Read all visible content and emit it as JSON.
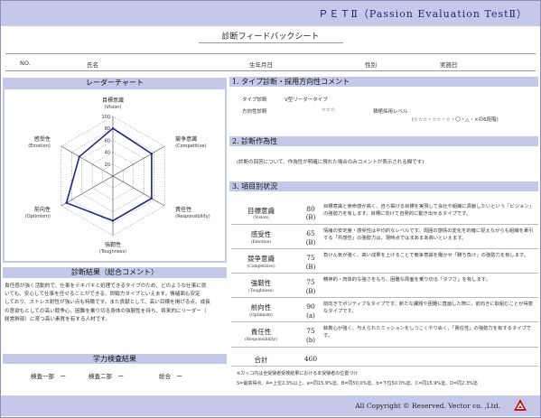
{
  "title": "ＰＥＴⅡ（Passion Evaluation TestⅡ）",
  "subtitle": "診断フィードバックシート",
  "header": {
    "no": "NO.",
    "name": "氏名",
    "birthdate": "生年月日",
    "gender": "性別",
    "date": "実施日"
  },
  "radar": {
    "title": "レーダーチャート",
    "scale_labels": [
      "100",
      "80",
      "60",
      "40",
      "20"
    ],
    "axes": [
      {
        "jp": "目標意識",
        "en": "(Vision)"
      },
      {
        "jp": "競争意識",
        "en": "(Competitive)"
      },
      {
        "jp": "責任性",
        "en": "(Responsibility)"
      },
      {
        "jp": "強靭性",
        "en": "(Toughness)"
      },
      {
        "jp": "前向性",
        "en": "(Optimism)"
      },
      {
        "jp": "感受性",
        "en": "(Emotion)"
      }
    ]
  },
  "chart_data": {
    "type": "radar",
    "categories": [
      "目標意識",
      "競争意識",
      "責任性",
      "強靭性",
      "前向性",
      "感受性"
    ],
    "values": [
      80,
      75,
      75,
      75,
      90,
      65
    ],
    "rlim": [
      0,
      100
    ]
  },
  "result": {
    "title": "診断結果（総合コメント）",
    "lines": [
      "責任感が強く活動的で、仕事をテキパキと処理できるタイプのため、どのような仕事に就",
      "いても、安心して仕事を任せることができる、即戦力タイプといえます。情緒面も安定",
      "しており、ストレス耐性が強い点も特徴です。また貢献として、高い目標を掲げる点、成長",
      "の意欲もとしての高い競争心、困難を乗り切る身体の強靭性を持ち、将来的にリーダー（",
      "経営幹部）に育つ高い素質を有する人材です。"
    ]
  },
  "kensa": {
    "title": "学力検査結果",
    "item1": "検査一部　ー",
    "item2": "検査二部　ー",
    "item3": "総合　ー"
  },
  "sec1": {
    "title": "1. タイプ診断・採用方向性コメント",
    "type_label": "タイプ診断",
    "type_value": "V型リーダータイプ",
    "hiring_label": "方向性診断",
    "hiring_value": "☆☆☆",
    "level_label": "積極採用レベル",
    "legend": "(☆☆☆・☆☆・☆・〇・△・×の6段階)"
  },
  "sec2": {
    "title": "2. 診断作為性",
    "note": "(診断の回答について、作為性が明確に現れた場合のみコメントが表示される欄です)"
  },
  "sec3": {
    "title": "3. 項目別状況",
    "items": [
      {
        "jp": "目標意識",
        "en": "(Vision)",
        "score": "80",
        "grade": "(B)",
        "text": "目標意識と使命感が高く、自ら掲げる目標を実現して会社や組織に貢献したいという「ビジョン」の強勢力を有します。目標に向けて自発的に動き出せるタイプです。"
      },
      {
        "jp": "感受性",
        "en": "(Emotion)",
        "score": "65",
        "grade": "(B)",
        "text": "情緒の安定度・感受性は平均的なレベルです。周囲の感情の変化を的確に捉えながらも組織を牽引する「共感性」の強勢力は、現時点ではまあまあ高いといえます。"
      },
      {
        "jp": "競争意識",
        "en": "(Competitive)",
        "score": "75",
        "grade": "(B)",
        "text": "負けん気が強く、高い成果を上げることで競争意識を働かせ「勝ち負け」の強勢力を有します。"
      },
      {
        "jp": "強靭性",
        "en": "(Toughness)",
        "score": "75",
        "grade": "(B)",
        "text": "精神的・肉体的な強さをもち、困難な局面を乗り切る「タフさ」を有します。"
      },
      {
        "jp": "前向性",
        "en": "(Optimism)",
        "score": "90",
        "grade": "(a)",
        "text": "前向きでポジティブなタイプです。新たな課題や困難に直面した際に、前向きに取組むことが得意なタイプです。"
      },
      {
        "jp": "責任性",
        "en": "(Responsibility)",
        "score": "75",
        "grade": "(b)",
        "text": "執着心が強く、与えられたミッションをしつこくやりぬく、「責任性」の強勢力を有するタイプです。"
      }
    ],
    "total_label": "合計",
    "total_value": "460",
    "note1": "※カッコ内は全受験者受検結果における本受験者の位置づけ",
    "note2": "S=最高得点、A=上位2.3%以上、a=同15.9%迄、B=同50.0%迄、b=下位50.0%迄、C=同15.9%迄、D=同2.3%迄"
  },
  "footer": {
    "copyright": "All Copyright © Reserved. Vector co. ,Ltd."
  },
  "colors": {
    "band": "#c5c8e8",
    "radar_line": "#1b2a80",
    "title_text": "#1e2a66"
  }
}
